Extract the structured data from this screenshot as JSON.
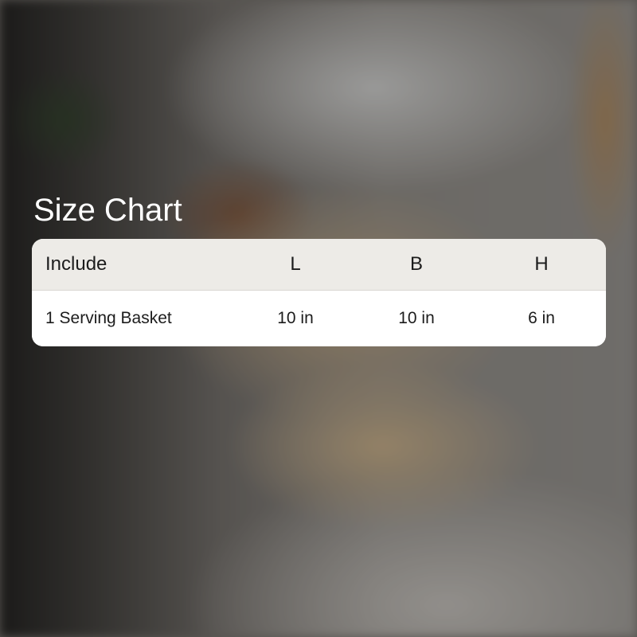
{
  "title": "Size Chart",
  "table": {
    "headers": [
      "Include",
      "L",
      "B",
      "H"
    ],
    "rows": [
      [
        "1 Serving Basket",
        "10 in",
        "10 in",
        "6 in"
      ]
    ]
  },
  "colors": {
    "header_bg": "#edebe7",
    "row_bg": "#ffffff",
    "title_text": "#ffffff",
    "cell_text": "#1c1c1c"
  }
}
